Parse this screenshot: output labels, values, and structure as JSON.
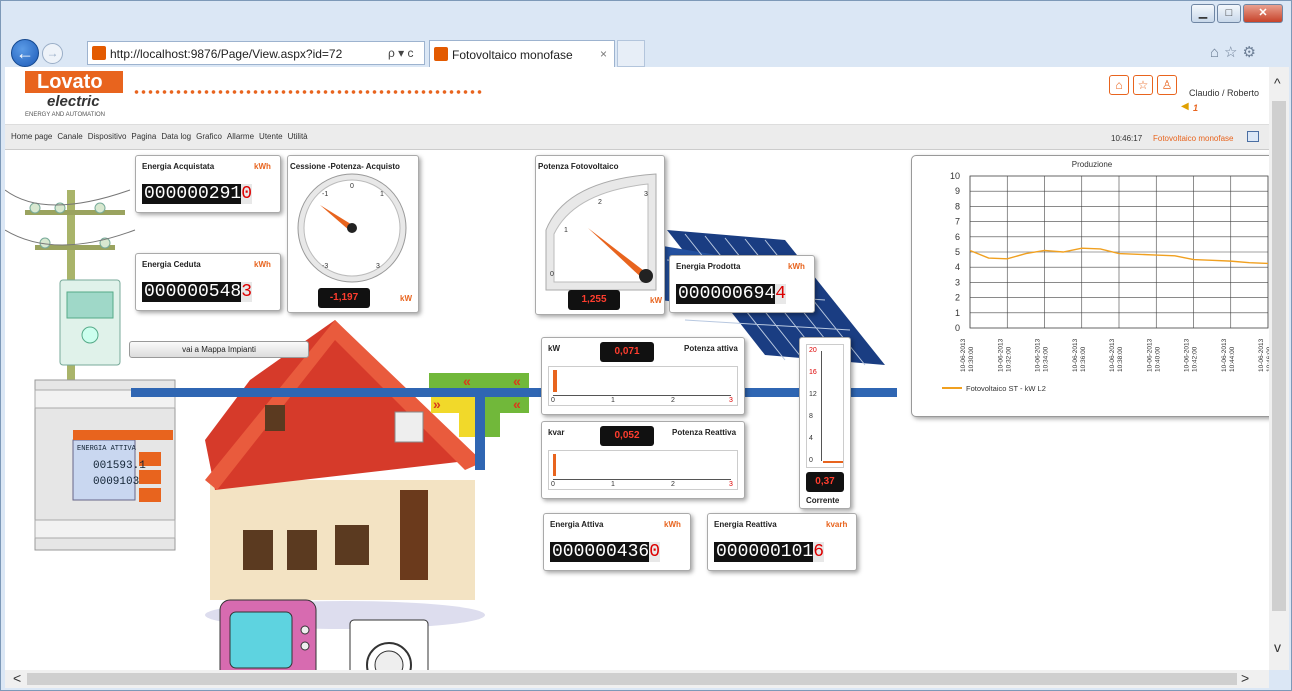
{
  "browser": {
    "url": "http://localhost:9876/Page/View.aspx?id=72",
    "tab_title": "Fotovoltaico monofase",
    "tab_close": "×",
    "search_refresh": "ρ ▾ c"
  },
  "header": {
    "logo_main": "Lovato",
    "logo_sub": "electric",
    "logo_tagline": "ENERGY AND AUTOMATION",
    "user": "Claudio / Roberto",
    "alarm_count": "1"
  },
  "menu": [
    "Home page",
    "Canale",
    "Dispositivo",
    "Pagina",
    "Data log",
    "Grafico",
    "Allarme",
    "Utente",
    "Utilità"
  ],
  "status": {
    "time": "10:46:17",
    "page_name": "Fotovoltaico monofase"
  },
  "panels": {
    "energia_acquistata": {
      "title": "Energia Acquistata",
      "unit": "kWh",
      "digits": "000000291",
      "last": "0"
    },
    "energia_ceduta": {
      "title": "Energia Ceduta",
      "unit": "kWh",
      "digits": "000000548",
      "last": "3"
    },
    "cessione": {
      "title": "Cessione -Potenza- Acquisto",
      "value": "-1,197",
      "unit": "kW",
      "ticks": [
        "-1",
        "0",
        "1",
        "-3",
        "3"
      ]
    },
    "potenza_fv": {
      "title": "Potenza Fotovoltaico",
      "value": "1,255",
      "unit": "kW",
      "ticks": [
        "0",
        "1",
        "2",
        "3"
      ]
    },
    "energia_prodotta": {
      "title": "Energia Prodotta",
      "unit": "kWh",
      "digits": "000000694",
      "last": "4"
    },
    "potenza_attiva": {
      "unit": "kW",
      "value": "0,071",
      "label": "Potenza attiva",
      "ticks": [
        "0",
        "1",
        "2",
        "3"
      ],
      "level": 0.024
    },
    "potenza_reattiva": {
      "unit": "kvar",
      "value": "0,052",
      "label": "Potenza Reattiva",
      "ticks": [
        "0",
        "1",
        "2",
        "3"
      ],
      "level": 0.017
    },
    "corrente": {
      "value": "0,37",
      "label": "Corrente",
      "ticks": [
        "20",
        "16",
        "12",
        "8",
        "4",
        "0"
      ],
      "level": 0.018
    },
    "energia_attiva": {
      "title": "Energia Attiva",
      "unit": "kWh",
      "digits": "000000436",
      "last": "0"
    },
    "energia_reattiva": {
      "title": "Energia Reattiva",
      "unit": "kvarh",
      "digits": "000000101",
      "last": "6"
    }
  },
  "map_button": "vai a Mappa Impianti",
  "meter_display": {
    "label": "ENERGIA ATTIVA",
    "line1": "001593.1",
    "line2": "0009103"
  },
  "flow_arrows": "«",
  "flow_arrows_right": "»",
  "chart_data": {
    "type": "line",
    "title": "Produzione",
    "x": [
      "10-06-2013 10:30:00",
      "10-06-2013 10:32:00",
      "10-06-2013 10:34:00",
      "10-06-2013 10:36:00",
      "10-06-2013 10:38:00",
      "10-06-2013 10:40:00",
      "10-06-2013 10:42:00",
      "10-06-2013 10:44:00",
      "10-06-2013 10:46:00"
    ],
    "x_tick_dates": [
      "10-06-2013",
      "10-06-2013",
      "10-06-2013",
      "10-06-2013",
      "10-06-2013",
      "10-06-2013",
      "10-06-2013",
      "10-06-2013",
      "10-06-2013"
    ],
    "x_tick_times": [
      "10:30:00",
      "10:32:00",
      "10:34:00",
      "10:36:00",
      "10:38:00",
      "10:40:00",
      "10:42:00",
      "10:44:00",
      "10:46:00"
    ],
    "series": [
      {
        "name": "Fotovoltaico ST - kW L2",
        "color": "#f0a020",
        "x": [
          0,
          0.5,
          1,
          1.5,
          2,
          2.5,
          3,
          3.5,
          4,
          4.5,
          5,
          5.5,
          6,
          6.5,
          7,
          7.5,
          8
        ],
        "values": [
          5.1,
          4.6,
          4.55,
          4.9,
          5.1,
          5.0,
          5.25,
          5.2,
          4.9,
          4.85,
          4.8,
          4.75,
          4.5,
          4.45,
          4.4,
          4.3,
          4.25
        ]
      }
    ],
    "yticks": [
      "0",
      "1",
      "2",
      "3",
      "4",
      "5",
      "6",
      "7",
      "8",
      "9",
      "10"
    ],
    "ylim": [
      0,
      10
    ],
    "grid": true,
    "legend": "bottom-left"
  }
}
